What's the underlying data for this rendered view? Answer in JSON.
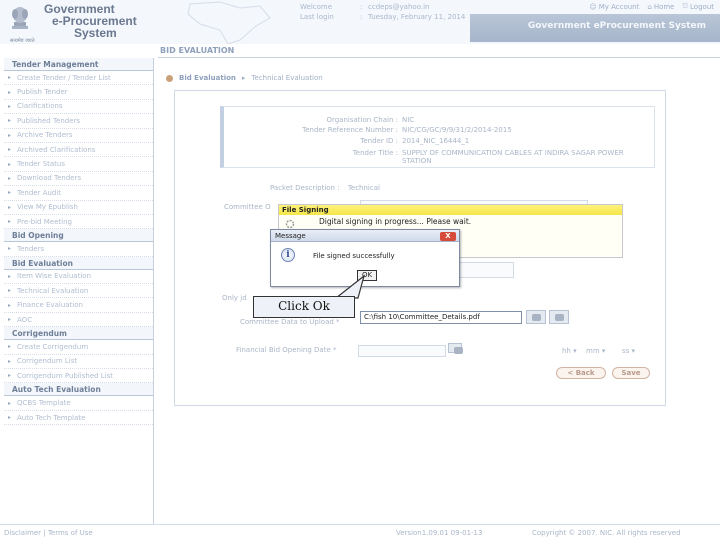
{
  "header": {
    "logo_lines": [
      "Government",
      "e-Procurement",
      "System"
    ],
    "logo_caption": "सत्यमेव जयते",
    "welcome_label": "Welcome",
    "welcome_value": "ccdeps@yahoo.in",
    "lastlogin_label": "Last login",
    "lastlogin_value": "Tuesday, February 11, 2014",
    "links": {
      "my_account": "My Account",
      "home": "Home",
      "logout": "Logout"
    },
    "system_title": "Government eProcurement System"
  },
  "page_title": "BID EVALUATION",
  "breadcrumb": {
    "step1": "Bid Evaluation",
    "step2": "Technical Evaluation"
  },
  "sidebar": {
    "sections": [
      {
        "title": "Tender Management",
        "items": [
          "Create Tender / Tender List",
          "Publish Tender",
          "Clarifications",
          "Published Tenders",
          "Archive Tenders",
          "Archived Clarifications",
          "Tender Status",
          "Download Tenders",
          "Tender Audit",
          "View My Epublish",
          "Pre-bid Meeting"
        ]
      },
      {
        "title": "Bid Opening",
        "items": [
          "Tenders"
        ]
      },
      {
        "title": "Bid Evaluation",
        "items": [
          "Item Wise Evaluation",
          "Technical Evaluation",
          "Finance Evaluation",
          "AOC"
        ]
      },
      {
        "title": "Corrigendum",
        "items": [
          "Create Corrigendum",
          "Corrigendum List",
          "Corrigendum Published List"
        ]
      },
      {
        "title": "Auto Tech Evaluation",
        "items": [
          "QCBS Template",
          "Auto Tech Template"
        ]
      }
    ]
  },
  "tender_info": {
    "org_label": "Organisation Chain :",
    "org_value": "NIC",
    "ref_label": "Tender Reference Number :",
    "ref_value": "NIC/CG/GC/9/9/31/2/2014-2015",
    "id_label": "Tender ID :",
    "id_value": "2014_NIC_16444_1",
    "title_label": "Tender Title :",
    "title_value": "SUPPLY OF COMMUNICATION CABLES AT INDIRA SAGAR POWER STATION"
  },
  "form": {
    "packet_label": "Packet Description :",
    "packet_value": "Technical",
    "committee_label": "Committee O",
    "only_label": "Only jd",
    "upload_label": "Committee Data to Upload *",
    "upload_value": "C:\\fish 10\\Committee_Details.pdf",
    "opening_date_label": "Financial Bid Opening Date *",
    "time_selects": [
      "hh",
      "mm",
      "ss"
    ],
    "back_label": "< Back",
    "save_label": "Save"
  },
  "signing_dialog": {
    "title": "File Signing",
    "message": "Digital signing in progress... Please wait."
  },
  "message_dialog": {
    "title": "Message",
    "close": "X",
    "text": "File signed successfully",
    "ok": "OK",
    "info_symbol": "i"
  },
  "callout": "Click Ok",
  "footer": {
    "links": "Disclaimer  |  Terms of Use",
    "version": "Version1.09.01 09-01-13",
    "copyright": "Copyright © 2007. NIC. All rights reserved"
  },
  "colors": {
    "accent": "#8ea0bb",
    "signing_title_bg": "#f5e64a",
    "msg_close": "#d64a3a"
  }
}
